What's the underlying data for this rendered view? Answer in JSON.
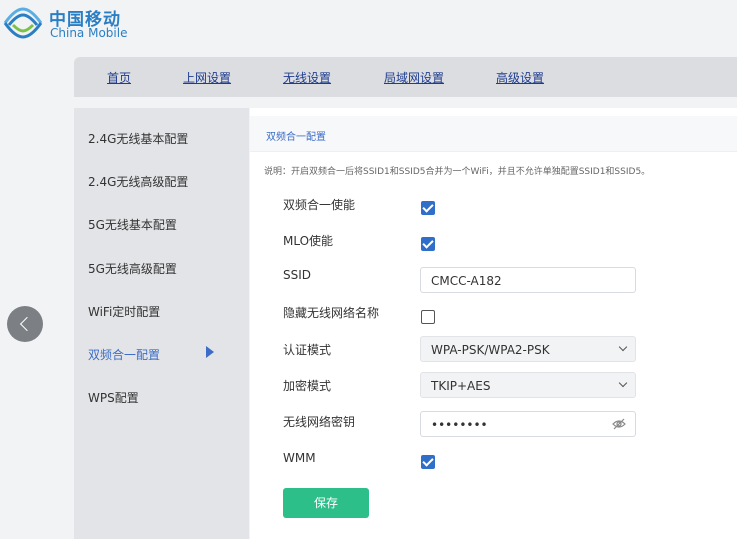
{
  "brand": {
    "name_cn": "中国移动",
    "name_en": "China Mobile"
  },
  "topnav": [
    "首页",
    "上网设置",
    "无线设置",
    "局域网设置",
    "高级设置"
  ],
  "sidebar": {
    "items": [
      {
        "label": "2.4G无线基本配置"
      },
      {
        "label": "2.4G无线高级配置"
      },
      {
        "label": "5G无线基本配置"
      },
      {
        "label": "5G无线高级配置"
      },
      {
        "label": "WiFi定时配置"
      },
      {
        "label": "双频合一配置",
        "active": true
      },
      {
        "label": "WPS配置"
      }
    ]
  },
  "section": {
    "title": "双频合一配置",
    "note": "说明：开启双频合一后将SSID1和SSID5合并为一个WiFi，并且不允许单独配置SSID1和SSID5。"
  },
  "form": {
    "dual_band_label": "双频合一使能",
    "dual_band_enabled": true,
    "mlo_label": "MLO使能",
    "mlo_enabled": true,
    "ssid_label": "SSID",
    "ssid_value": "CMCC-A182",
    "hide_ssid_label": "隐藏无线网络名称",
    "hide_ssid_enabled": false,
    "auth_label": "认证模式",
    "auth_value": "WPA-PSK/WPA2-PSK",
    "encrypt_label": "加密模式",
    "encrypt_value": "TKIP+AES",
    "password_label": "无线网络密钥",
    "password_value": "••••••••",
    "wmm_label": "WMM",
    "wmm_enabled": true,
    "save_label": "保存"
  },
  "colors": {
    "accent": "#3b6cc6",
    "checkbox": "#2f6fc9",
    "save": "#2dbf8a",
    "nav_link": "#1e3d8f"
  },
  "icons": [
    "china-mobile-logo-icon",
    "chevron-down-icon",
    "eye-off-icon",
    "chevron-left-icon",
    "caret-right-icon"
  ]
}
